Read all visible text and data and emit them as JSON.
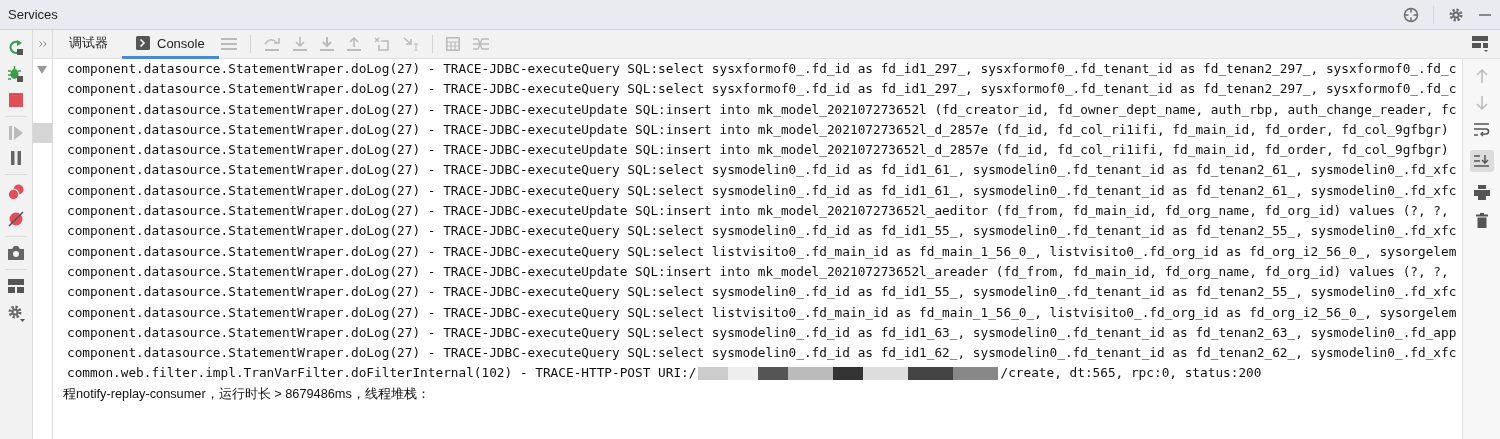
{
  "window": {
    "title": "Services"
  },
  "tabs": [
    {
      "label": "调试器",
      "selected": false,
      "icon": false
    },
    {
      "label": "Console",
      "selected": true,
      "icon": true
    }
  ],
  "right_toolbar": {
    "scroll_to_end_on": true
  },
  "log_lines": [
    {
      "kind": "log",
      "text": "component.datasource.StatementWraper.doLog(27) - TRACE-JDBC-executeQuery SQL:select sysxformof0_.fd_id as fd_id1_297_, sysxformof0_.fd_tenant_id as fd_tenan2_297_, sysxformof0_.fd_c"
    },
    {
      "kind": "log",
      "text": "component.datasource.StatementWraper.doLog(27) - TRACE-JDBC-executeQuery SQL:select sysxformof0_.fd_id as fd_id1_297_, sysxformof0_.fd_tenant_id as fd_tenan2_297_, sysxformof0_.fd_c"
    },
    {
      "kind": "log",
      "text": "component.datasource.StatementWraper.doLog(27) - TRACE-JDBC-executeUpdate SQL:insert into mk_model_202107273652l (fd_creator_id, fd_owner_dept_name, auth_rbp, auth_change_reader, fc"
    },
    {
      "kind": "log",
      "text": "component.datasource.StatementWraper.doLog(27) - TRACE-JDBC-executeUpdate SQL:insert into mk_model_202107273652l_d_2857e (fd_id, fd_col_ri1ifi, fd_main_id, fd_order, fd_col_9gfbgr)"
    },
    {
      "kind": "log",
      "text": "component.datasource.StatementWraper.doLog(27) - TRACE-JDBC-executeUpdate SQL:insert into mk_model_202107273652l_d_2857e (fd_id, fd_col_ri1ifi, fd_main_id, fd_order, fd_col_9gfbgr)"
    },
    {
      "kind": "log",
      "text": "component.datasource.StatementWraper.doLog(27) - TRACE-JDBC-executeQuery SQL:select sysmodelin0_.fd_id as fd_id1_61_, sysmodelin0_.fd_tenant_id as fd_tenan2_61_, sysmodelin0_.fd_xfc"
    },
    {
      "kind": "log",
      "text": "component.datasource.StatementWraper.doLog(27) - TRACE-JDBC-executeQuery SQL:select sysmodelin0_.fd_id as fd_id1_61_, sysmodelin0_.fd_tenant_id as fd_tenan2_61_, sysmodelin0_.fd_xfc"
    },
    {
      "kind": "log",
      "text": "component.datasource.StatementWraper.doLog(27) - TRACE-JDBC-executeUpdate SQL:insert into mk_model_202107273652l_aeditor (fd_from, fd_main_id, fd_org_name, fd_org_id) values (?, ?,"
    },
    {
      "kind": "log",
      "text": "component.datasource.StatementWraper.doLog(27) - TRACE-JDBC-executeQuery SQL:select sysmodelin0_.fd_id as fd_id1_55_, sysmodelin0_.fd_tenant_id as fd_tenan2_55_, sysmodelin0_.fd_xfc"
    },
    {
      "kind": "log",
      "text": "component.datasource.StatementWraper.doLog(27) - TRACE-JDBC-executeQuery SQL:select listvisito0_.fd_main_id as fd_main_1_56_0_, listvisito0_.fd_org_id as fd_org_i2_56_0_, sysorgelem"
    },
    {
      "kind": "log",
      "text": "component.datasource.StatementWraper.doLog(27) - TRACE-JDBC-executeUpdate SQL:insert into mk_model_202107273652l_areader (fd_from, fd_main_id, fd_org_name, fd_org_id) values (?, ?,"
    },
    {
      "kind": "log",
      "text": "component.datasource.StatementWraper.doLog(27) - TRACE-JDBC-executeQuery SQL:select sysmodelin0_.fd_id as fd_id1_55_, sysmodelin0_.fd_tenant_id as fd_tenan2_55_, sysmodelin0_.fd_xfc"
    },
    {
      "kind": "log",
      "text": "component.datasource.StatementWraper.doLog(27) - TRACE-JDBC-executeQuery SQL:select listvisito0_.fd_main_id as fd_main_1_56_0_, listvisito0_.fd_org_id as fd_org_i2_56_0_, sysorgelem"
    },
    {
      "kind": "log",
      "text": "component.datasource.StatementWraper.doLog(27) - TRACE-JDBC-executeQuery SQL:select sysmodelin0_.fd_id as fd_id1_63_, sysmodelin0_.fd_tenant_id as fd_tenan2_63_, sysmodelin0_.fd_app"
    },
    {
      "kind": "log",
      "text": "component.datasource.StatementWraper.doLog(27) - TRACE-JDBC-executeQuery SQL:select sysmodelin0_.fd_id as fd_id1_62_, sysmodelin0_.fd_tenant_id as fd_tenan2_62_, sysmodelin0_.fd_xfc"
    },
    {
      "kind": "redacted",
      "prefix": "common.web.filter.impl.TranVarFilter.doFilterInternal(102) - TRACE-HTTP-POST URI:/",
      "suffix": "/create, dt:565, rpc:0, status:200"
    },
    {
      "kind": "raw",
      "text": "程notify-replay-consumer，运行时长 > 8679486ms，线程堆栈："
    }
  ]
}
